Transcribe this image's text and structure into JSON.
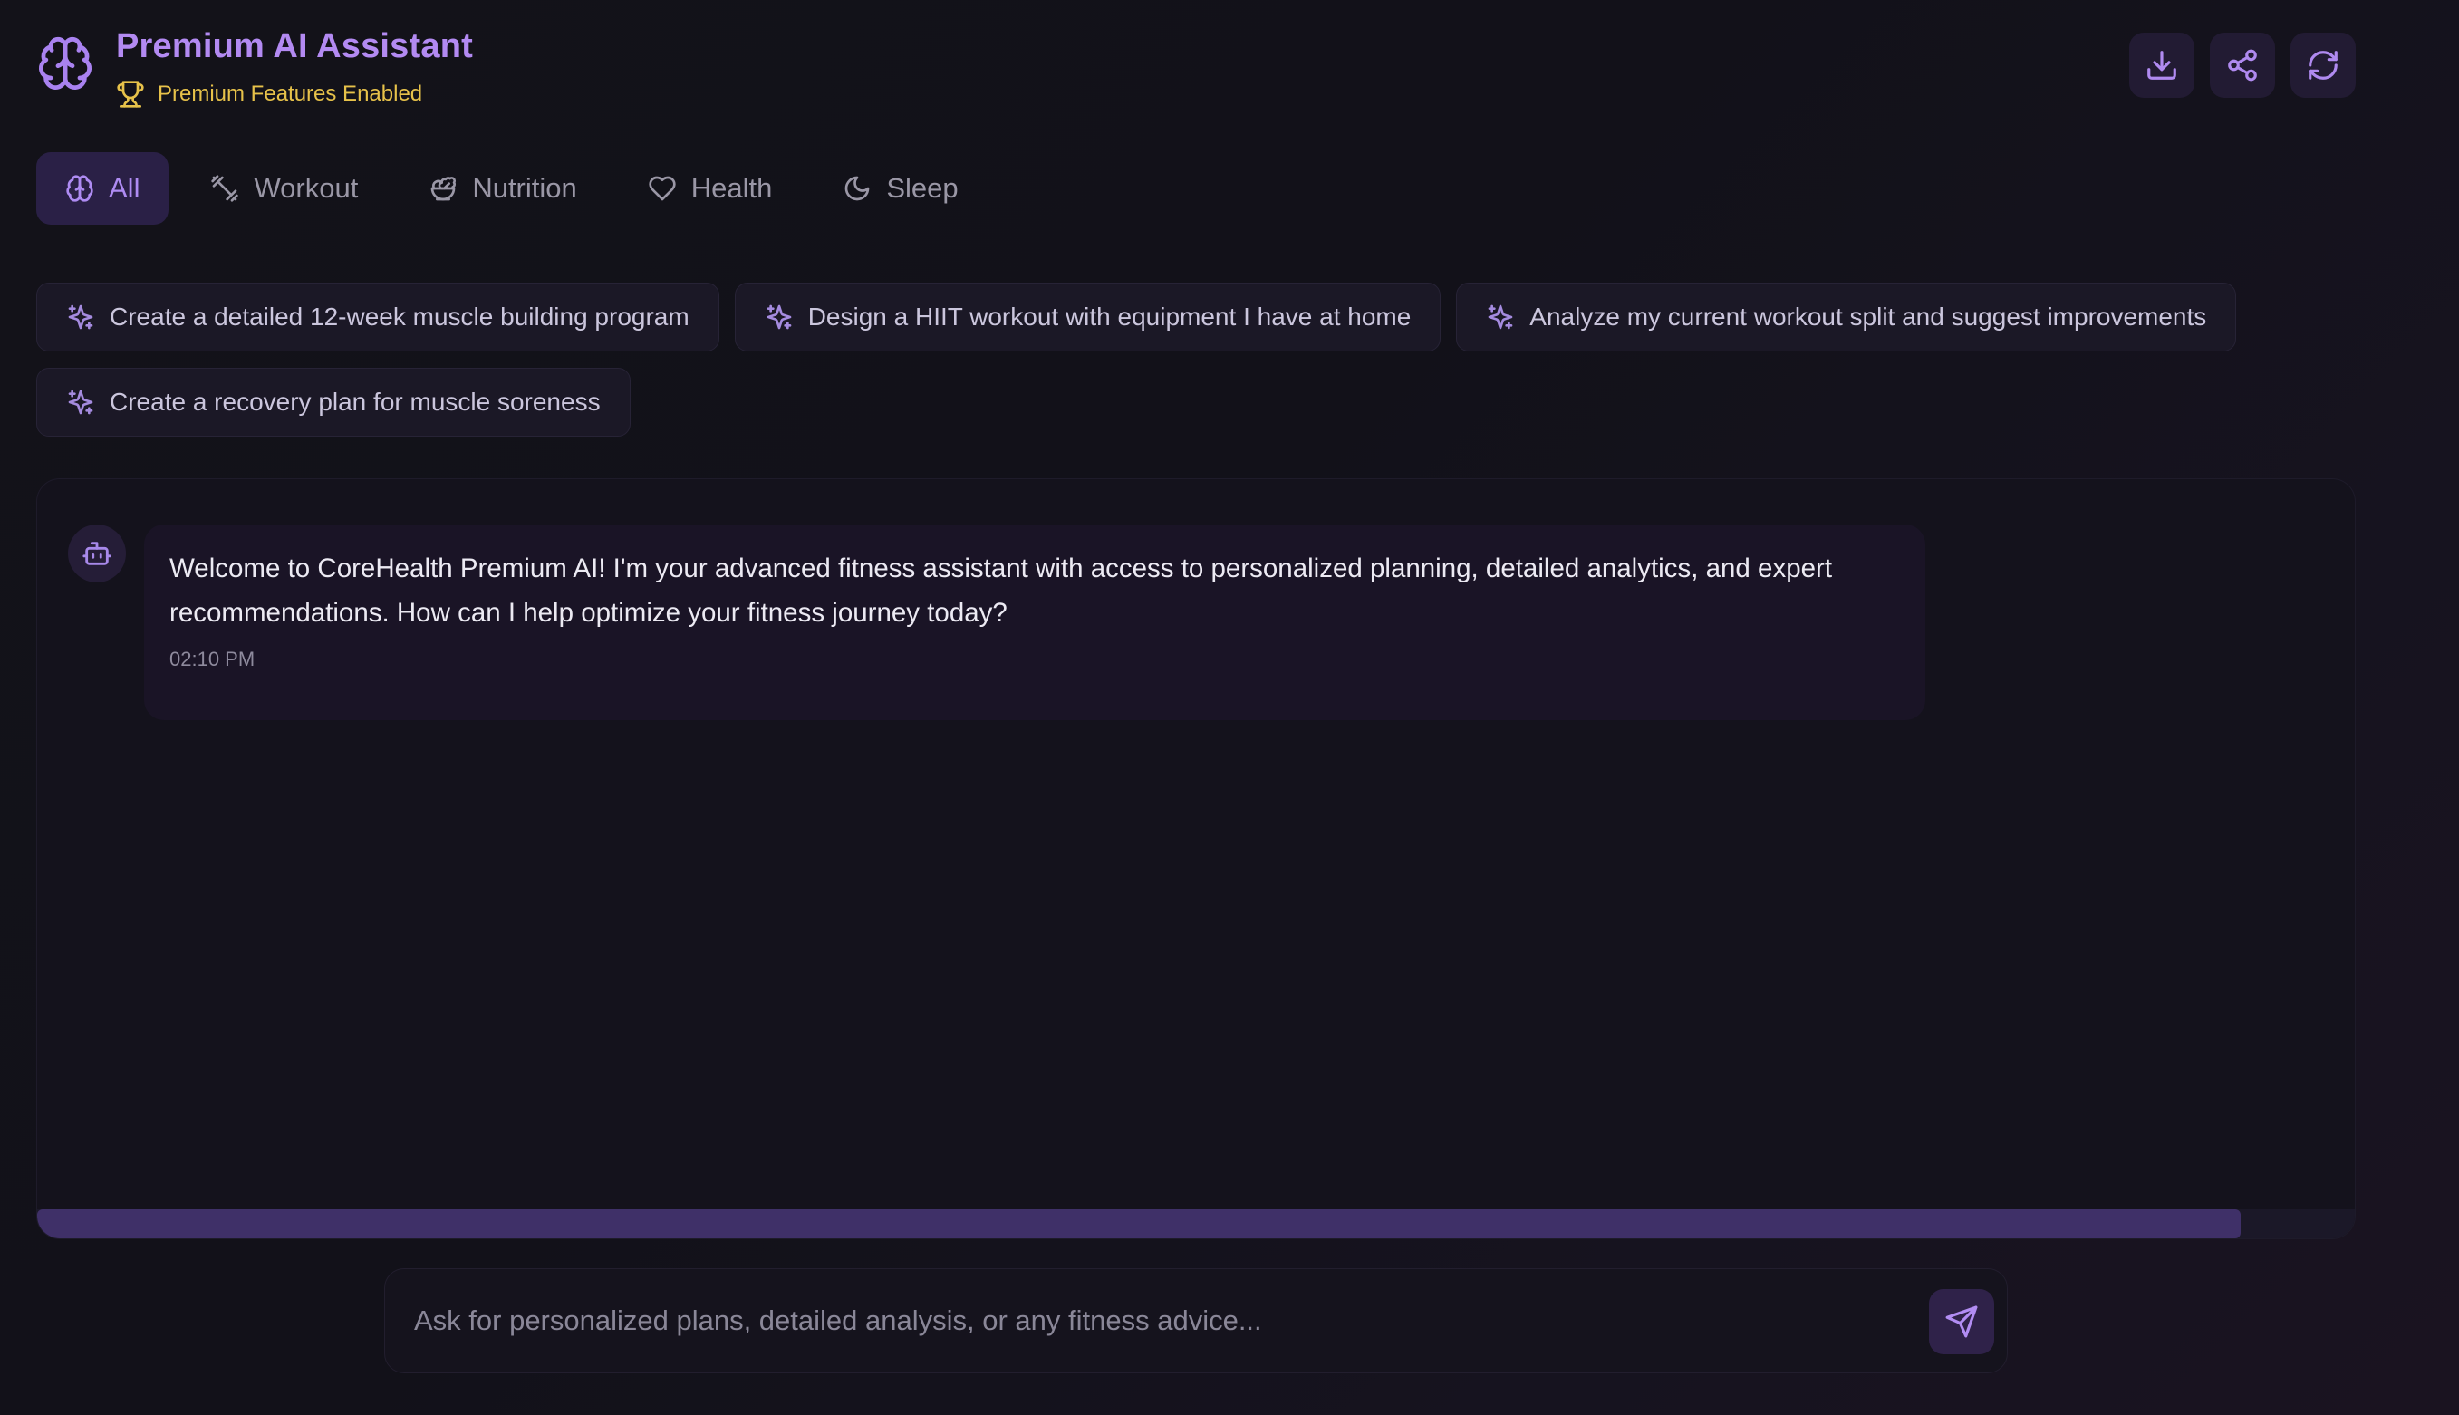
{
  "header": {
    "title": "Premium AI Assistant",
    "subtitle": "Premium Features Enabled",
    "actions": [
      {
        "name": "download",
        "icon": "download-icon"
      },
      {
        "name": "share",
        "icon": "share-icon"
      },
      {
        "name": "refresh",
        "icon": "refresh-icon"
      }
    ]
  },
  "tabs": [
    {
      "label": "All",
      "icon": "brain-icon",
      "active": true
    },
    {
      "label": "Workout",
      "icon": "dumbbell-icon",
      "active": false
    },
    {
      "label": "Nutrition",
      "icon": "salad-icon",
      "active": false
    },
    {
      "label": "Health",
      "icon": "heart-icon",
      "active": false
    },
    {
      "label": "Sleep",
      "icon": "moon-icon",
      "active": false
    }
  ],
  "suggestions": [
    "Create a detailed 12-week muscle building program",
    "Design a HIIT workout with equipment I have at home",
    "Analyze my current workout split and suggest improvements",
    "Create a recovery plan for muscle soreness"
  ],
  "chat": {
    "messages": [
      {
        "sender": "bot",
        "text": "Welcome to CoreHealth Premium AI! I'm your advanced fitness assistant with access to personalized planning, detailed analytics, and expert recommendations. How can I help optimize your fitness journey today?",
        "time": "02:10 PM"
      }
    ],
    "scroll_position_fraction": 0.95
  },
  "input": {
    "placeholder": "Ask for personalized plans, detailed analysis, or any fitness advice...",
    "value": ""
  },
  "colors": {
    "accent": "#b38af2",
    "premium": "#e7c24a",
    "background": "#131219"
  }
}
